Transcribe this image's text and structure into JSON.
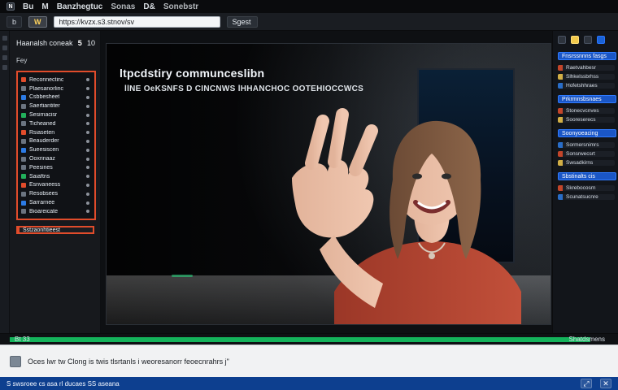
{
  "topbar": {
    "logo_glyph": "N",
    "item1": "Bu",
    "item2": "M",
    "item3": "Banzhegtuc",
    "item4": "Sonas",
    "item5": "D&",
    "item6": "Sonebstr"
  },
  "toolbar": {
    "btn_left": "b",
    "btn_accent": "W",
    "address": "https://kvzx.s3.stnov/sv",
    "btn_right": "Sgest"
  },
  "sidebar": {
    "header_left": "Haanalsh coneak",
    "header_count": "5",
    "header_right": "10",
    "subheader": "Fey",
    "items": [
      "Reconnectinc",
      "Plaesanorlinc",
      "Csbbesheet",
      "Saertiantiter",
      "Sesimacisr",
      "Ticheaned",
      "Rsiaseten",
      "Beauderder",
      "Sueesiscen",
      "Ooxrinaaz",
      "Peesines",
      "Saiaftns",
      "Esnvaneess",
      "Resobsees",
      "Sarrarnee",
      "Bioareicate"
    ],
    "bottom_highlight": "Sstzaonhtieest"
  },
  "video": {
    "title": "ltpcdstiry communceslibn",
    "subtitle": "llNE OeKSNFS D CINCNWS lHHANCHOC OOTEHIOCCWCS"
  },
  "right_panel": {
    "bar1": "Fnsrssnnns fasgs",
    "bar2": "Prkrmnsbsnaes",
    "bar3": "Soonyoeacing",
    "bar4": "Sbstinalts cis",
    "lines": [
      "Raetvahbesr",
      "Slhkelssbrhss",
      "Hofetshhraes",
      "Stonecvcnves",
      "Sooreserecs",
      "Sormersnimrs",
      "Sonsrwecsrt",
      "Swsadkirns",
      "Skrebocosrn",
      "Scunatsucnre"
    ]
  },
  "progress": {
    "left": "Bt  33",
    "right": "Shatdsmens",
    "percent": 97
  },
  "caption": {
    "text": "Oces lwr tw Clong is twis tlsrtanls i weoresanorr feoecnrahrs j\""
  },
  "statusbar": {
    "text": "S swsroee cs asa rl ducaes SS aseana",
    "right_btn1": "⤢",
    "right_btn2": "✕"
  },
  "colors": {
    "accent_red": "#e14c2b",
    "accent_green": "#14b35b",
    "accent_blue": "#1a56c6",
    "status_blue": "#0d3f8f"
  }
}
